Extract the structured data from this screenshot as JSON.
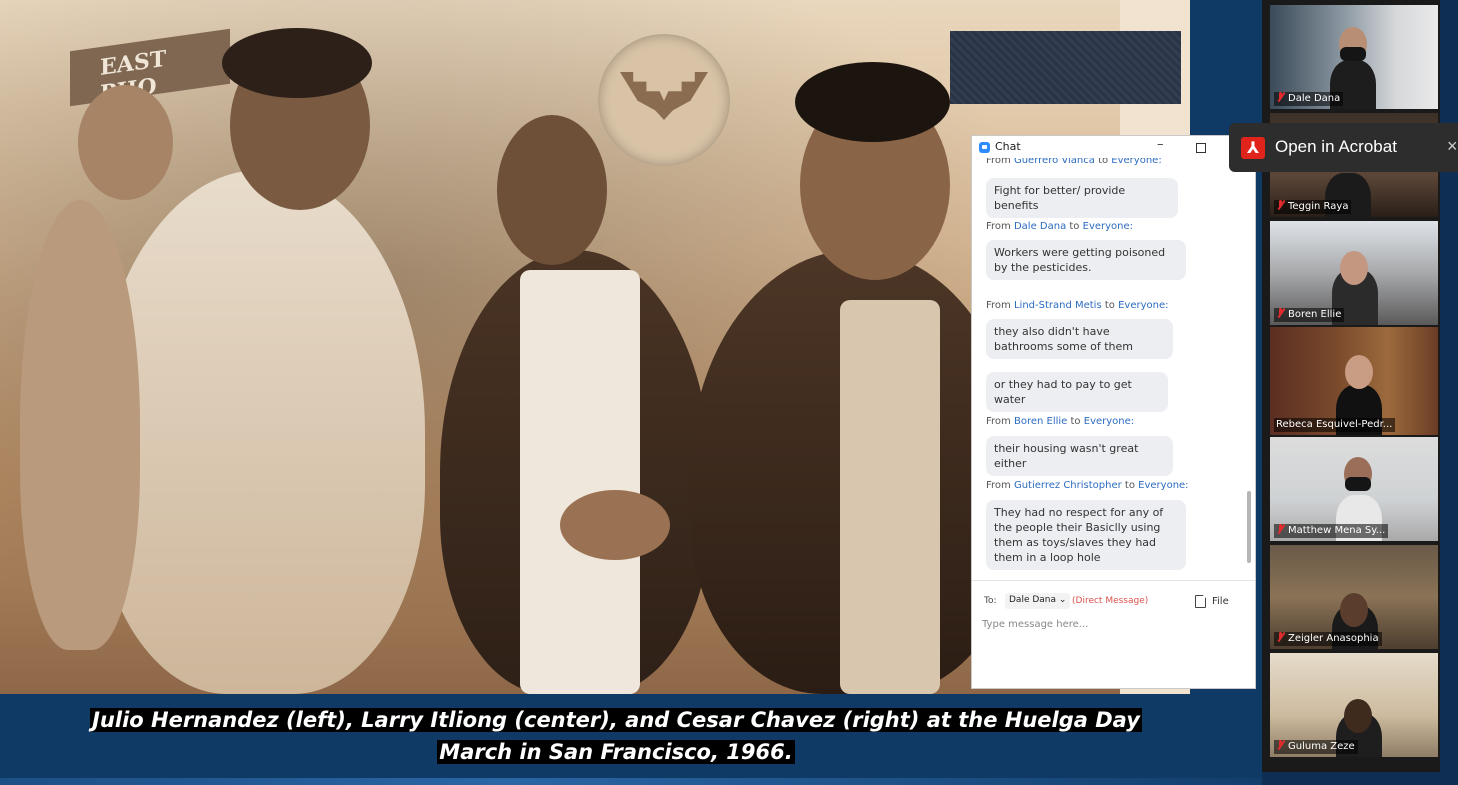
{
  "slide": {
    "storefront_sign": "EAST PHO",
    "caption_line1": "Julio Hernandez (left), Larry Itliong (center), and Cesar Chavez (right) at the Huelga Day",
    "caption_line2": "March in San Francisco, 1966."
  },
  "chat": {
    "title": "Chat",
    "messages": [
      {
        "from": "From",
        "sender": "Guerrero Vianca",
        "to_word": "to",
        "recipient": "Everyone:",
        "lines": [
          "Fight for better/ provide benefits"
        ]
      },
      {
        "from": "From",
        "sender": "Dale Dana",
        "to_word": "to",
        "recipient": "Everyone:",
        "lines": [
          "Workers were getting poisoned by the pesticides."
        ]
      },
      {
        "from": "From",
        "sender": "Lind-Strand Metis",
        "to_word": "to",
        "recipient": "Everyone:",
        "lines": [
          "they also didn't have bathrooms some of them",
          "or they had to pay to get water"
        ]
      },
      {
        "from": "From",
        "sender": "Boren Ellie",
        "to_word": "to",
        "recipient": "Everyone:",
        "lines": [
          "their housing wasn't great either"
        ]
      },
      {
        "from": "From",
        "sender": "Gutierrez Christopher",
        "to_word": "to",
        "recipient": "Everyone:",
        "lines": [
          "They had no respect for any of the people their Basiclly using them as toys/slaves they had them in a loop hole"
        ]
      }
    ],
    "to_label": "To:",
    "to_value": "Dale Dana ⌄",
    "direct_message": "(Direct Message)",
    "file_label": "File",
    "input_placeholder": "Type message here..."
  },
  "acrobat": {
    "label": "Open in Acrobat",
    "close": "×",
    "icon": "acrobat-icon"
  },
  "participants": [
    {
      "name": "Dale Dana",
      "muted": true,
      "active": false
    },
    {
      "name": "Teggin Raya",
      "muted": true,
      "active": false
    },
    {
      "name": "Boren Ellie",
      "muted": true,
      "active": false
    },
    {
      "name": "Rebeca Esquivel-Pedr...",
      "muted": false,
      "active": true
    },
    {
      "name": "Matthew Mena Sy...",
      "muted": true,
      "active": false
    },
    {
      "name": "Zeigler Anasophia",
      "muted": true,
      "active": false
    },
    {
      "name": "Guluma Zeze",
      "muted": true,
      "active": false
    }
  ],
  "colors": {
    "slide_background": "#0f3a66",
    "chat_link": "#2d6cc0",
    "direct_message": "#d9534f",
    "active_speaker_border": "#dcdc4a",
    "muted_icon": "#e02c2c",
    "acrobat_red": "#e0241b"
  }
}
